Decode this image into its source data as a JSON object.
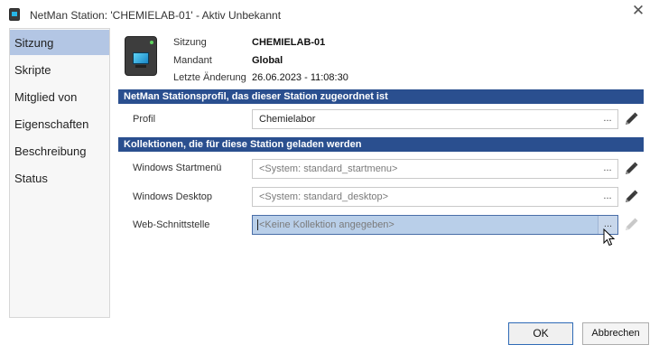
{
  "window": {
    "title": "NetMan Station: 'CHEMIELAB-01' - Aktiv Unbekannt",
    "close_icon": "close-icon"
  },
  "sidebar": {
    "items": [
      {
        "label": "Sitzung",
        "active": true
      },
      {
        "label": "Skripte",
        "active": false
      },
      {
        "label": "Mitglied von",
        "active": false
      },
      {
        "label": "Eigenschaften",
        "active": false
      },
      {
        "label": "Beschreibung",
        "active": false
      },
      {
        "label": "Status",
        "active": false
      }
    ]
  },
  "header": {
    "station_icon": "workstation-icon",
    "session_label": "Sitzung",
    "session_value": "CHEMIELAB-01",
    "tenant_label": "Mandant",
    "tenant_value": "Global",
    "last_change_label": "Letzte Änderung",
    "last_change_value": "26.06.2023 - 11:08:30"
  },
  "profile_section": {
    "title": "NetMan Stationsprofil, das dieser Station zugeordnet ist",
    "profile_label": "Profil",
    "profile_value": "Chemielabor",
    "browse_label": "..."
  },
  "collections_section": {
    "title": "Kollektionen, die für diese Station geladen werden",
    "rows": [
      {
        "label": "Windows Startmenü",
        "value": "<System: standard_startmenu>",
        "browse": "...",
        "editable": true
      },
      {
        "label": "Windows Desktop",
        "value": "<System: standard_desktop>",
        "browse": "...",
        "editable": true
      },
      {
        "label": "Web-Schnittstelle",
        "value": "<Keine Kollektion angegeben>",
        "browse": "...",
        "editable": false
      }
    ]
  },
  "buttons": {
    "ok": "OK",
    "cancel": "Abbrechen"
  },
  "colors": {
    "section_header": "#2a4f8f",
    "selection": "#b3c6e4",
    "focused_field": "#b9cfe9"
  }
}
